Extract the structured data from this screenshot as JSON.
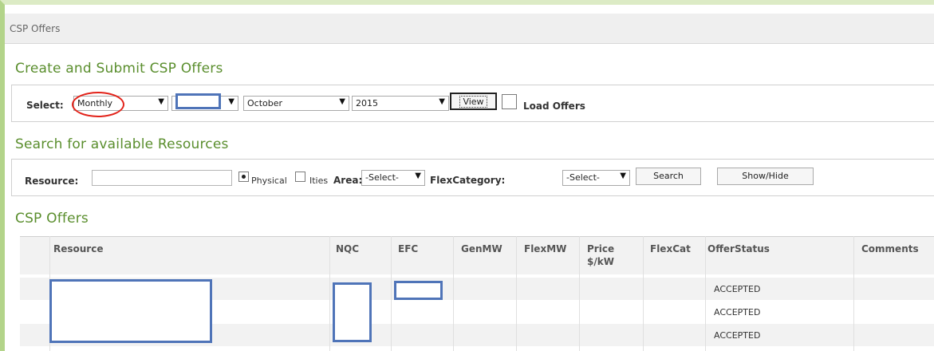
{
  "window_title": "CSP Offers",
  "create_section": {
    "title": "Create and Submit CSP Offers",
    "select_label": "Select:",
    "period_type": "Monthly",
    "period_value": "",
    "month": "October",
    "year": "2015",
    "view_label": "View",
    "load_offers_label": "Load Offers",
    "load_offers_checked": false
  },
  "search_section": {
    "title": "Search for available Resources",
    "resource_label": "Resource:",
    "resource_value": "",
    "physical_label": "Physical",
    "physical_selected": true,
    "ities_label": "Ities",
    "ities_selected": false,
    "area_label": "Area:",
    "area_value": "-Select-",
    "flexcat_label": "FlexCategory:",
    "flexcat_value": "-Select-",
    "search_label": "Search",
    "showhide_label": "Show/Hide"
  },
  "offers_section": {
    "title": "CSP Offers",
    "columns": {
      "resource": "Resource",
      "nqc": "NQC",
      "efc": "EFC",
      "genmw": "GenMW",
      "flexmw": "FlexMW",
      "price_line1": "Price",
      "price_line2": "$/kW",
      "flexcat": "FlexCat",
      "offerstatus": "OfferStatus",
      "comments": "Comments"
    },
    "rows": [
      {
        "offer_status": "ACCEPTED"
      },
      {
        "offer_status": "ACCEPTED"
      },
      {
        "offer_status": "ACCEPTED"
      }
    ]
  },
  "colors": {
    "section_title": "#5a8e2d",
    "annotation_circle": "#e2231a",
    "redaction_box": "#4f74b8"
  }
}
